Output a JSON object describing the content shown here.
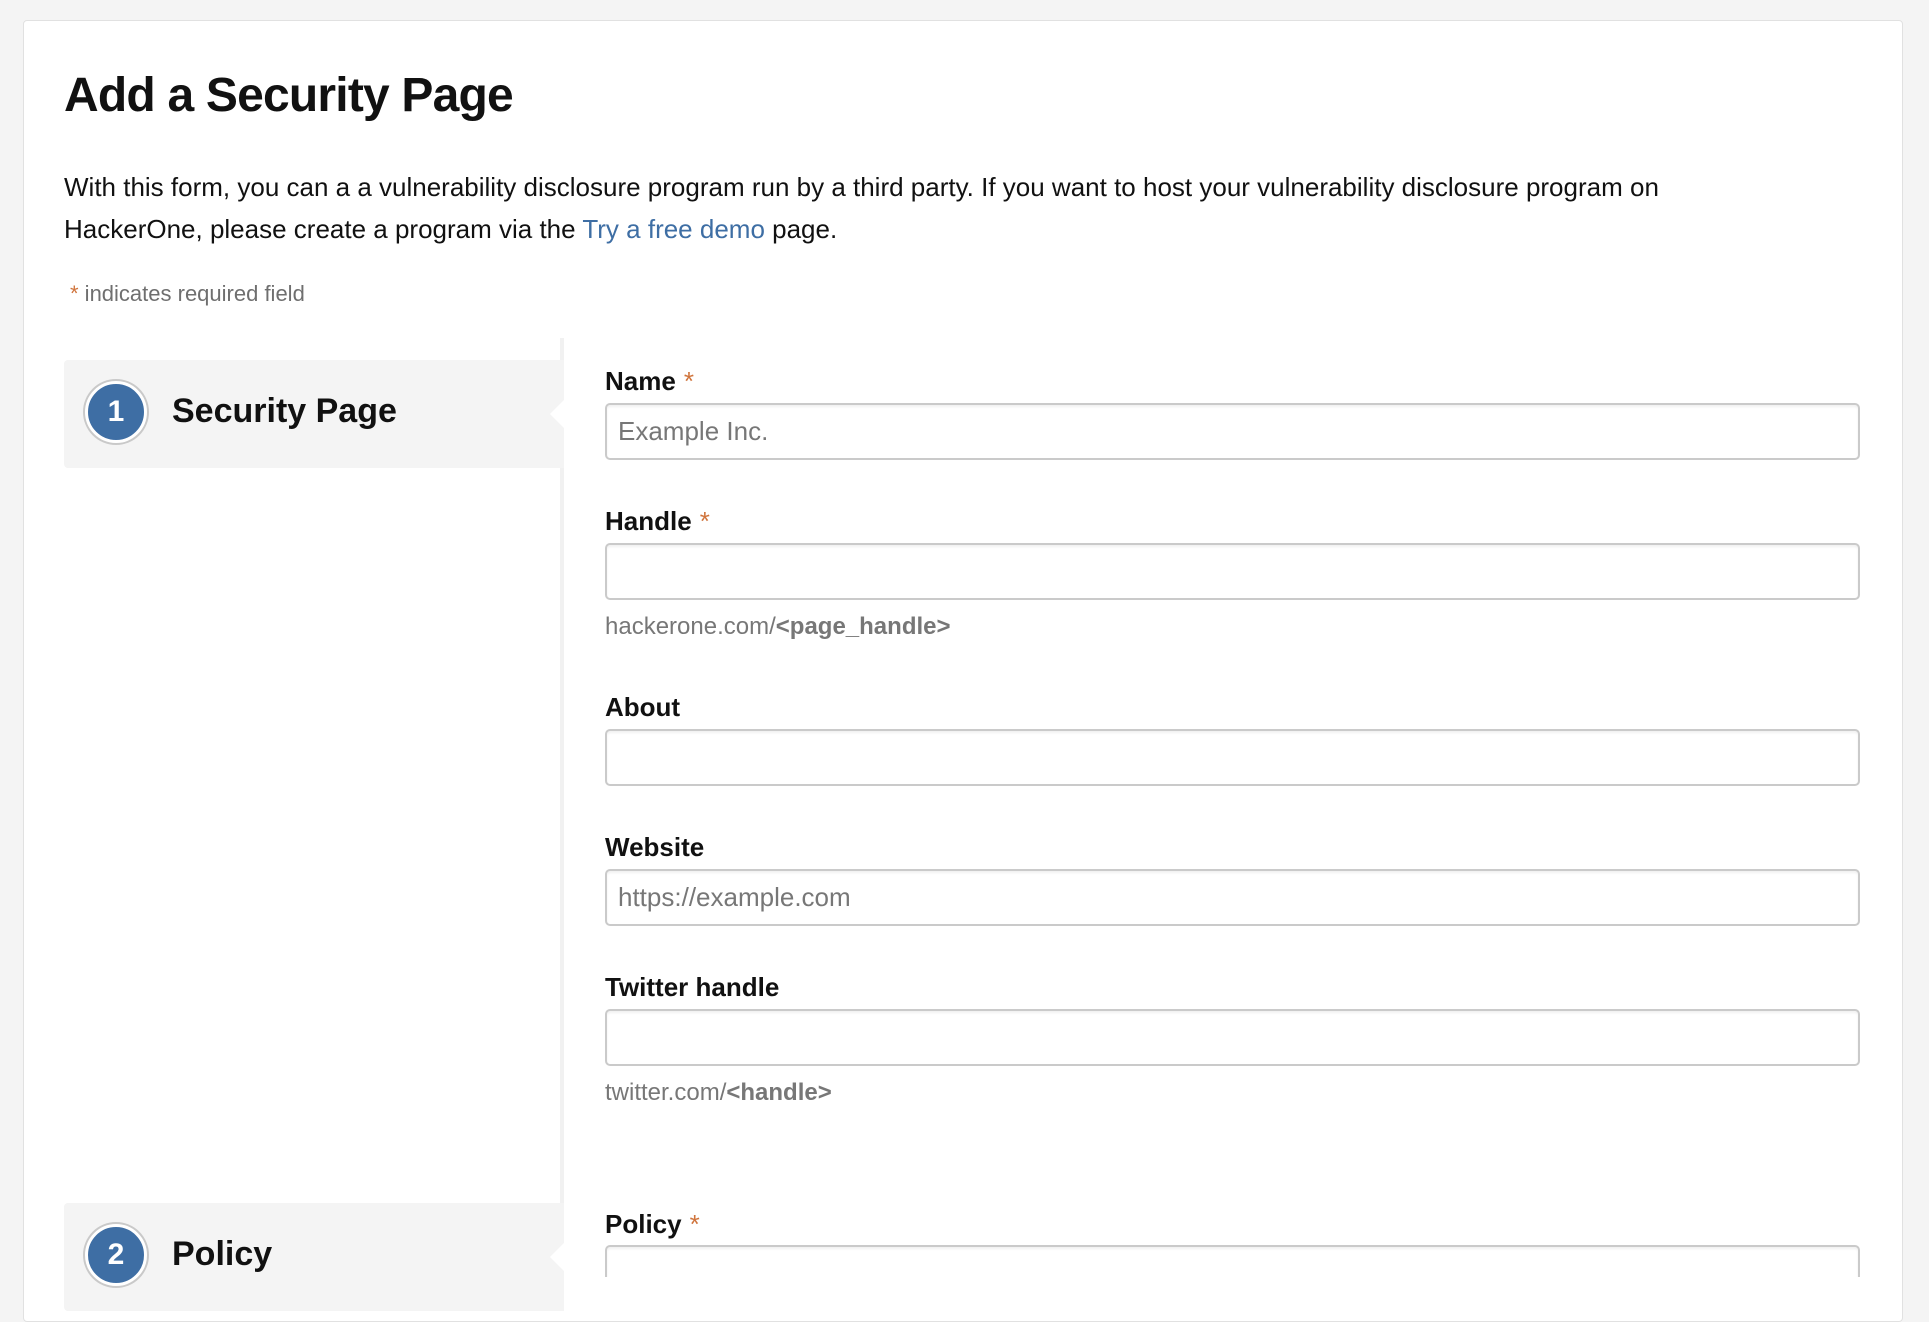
{
  "page": {
    "title": "Add a Security Page",
    "intro_before_link": "With this form, you can a a vulnerability disclosure program run by a third party. If you want to host your vulnerability disclosure program on HackerOne, please create a program via the ",
    "intro_link": "Try a free demo",
    "intro_after_link": " page.",
    "required_star": "*",
    "required_note": " indicates required field"
  },
  "steps": [
    {
      "number": "1",
      "label": "Security Page"
    },
    {
      "number": "2",
      "label": "Policy"
    }
  ],
  "form": {
    "name": {
      "label": "Name",
      "placeholder": "Example Inc.",
      "value": ""
    },
    "handle": {
      "label": "Handle",
      "value": "",
      "hint_prefix": "hackerone.com/",
      "hint_token": "<page_handle>"
    },
    "about": {
      "label": "About",
      "value": ""
    },
    "website": {
      "label": "Website",
      "placeholder": "https://example.com",
      "value": ""
    },
    "twitter": {
      "label": "Twitter handle",
      "value": "",
      "hint_prefix": "twitter.com/",
      "hint_token": "<handle>"
    },
    "policy": {
      "label": "Policy",
      "value": ""
    }
  },
  "colors": {
    "accent": "#3e6ea4",
    "required_star": "#d0743c",
    "muted_text": "#777777"
  }
}
